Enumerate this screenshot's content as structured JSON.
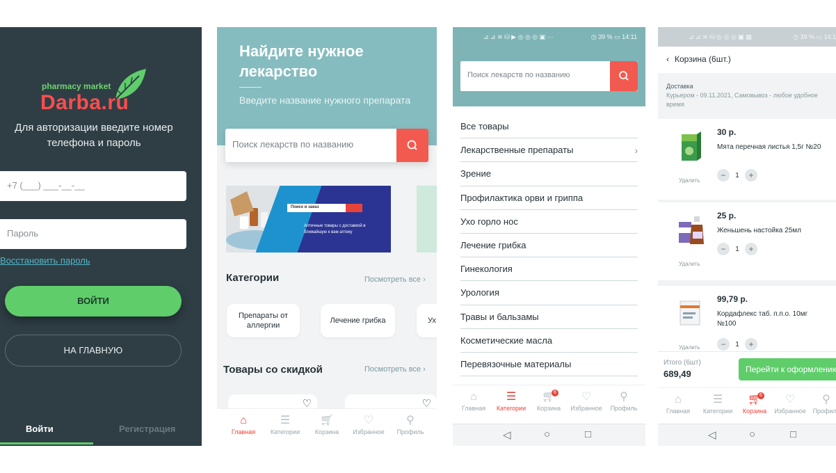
{
  "login_screen": {
    "logo_small": "pharmacy market",
    "logo_big": "Darba.ru",
    "auth_prompt": "Для авторизации введите номер телефона и пароль",
    "phone_placeholder": "+7 (___) ___-__-__",
    "password_placeholder": "Пароль",
    "restore_link": "Восстановить пароль",
    "login_button": "ВОЙТИ",
    "home_button": "НА ГЛАВНУЮ",
    "tabs": [
      "Войти",
      "Регистрация"
    ],
    "colors": {
      "background": "#2f3e45",
      "accent": "#5ecd6a",
      "brand_red": "#ff4d4d"
    }
  },
  "home_screen": {
    "hero_title": "Найдите нужное лекарство",
    "hero_subtitle": "Введите название нужного препарата",
    "search_placeholder": "Поиск лекарств по названию",
    "banner": {
      "search_text": "Поиск и заказ",
      "text": "Аптечные товары с доставкой в ближайшую к вам аптеку"
    },
    "categories_title": "Категории",
    "categories_see_all": "Посмотреть все",
    "categories": [
      "Препараты от аллергии",
      "Лечение грибка",
      "Ух"
    ],
    "discount_title": "Товары со скидкой",
    "discount_see_all": "Посмотреть все",
    "colors": {
      "hero": "#85bcbf",
      "search_button": "#f25a4f"
    }
  },
  "tabbar": {
    "items": [
      {
        "label": "Главная",
        "icon": "home-icon"
      },
      {
        "label": "Категории",
        "icon": "menu-icon"
      },
      {
        "label": "Корзина",
        "icon": "cart-icon"
      },
      {
        "label": "Избранное",
        "icon": "heart-icon"
      },
      {
        "label": "Профиль",
        "icon": "user-icon"
      }
    ],
    "cart_badge": "6"
  },
  "categories_screen": {
    "status_left": "⊿ ⊿ ≋ ⛁ ▶ ◎ ◎ ◎ ▣ ···",
    "status_right": "◷ 39 % ▭ 14:11",
    "search_placeholder": "Поиск лекарств по названию",
    "items": [
      "Все товары",
      "Лекарственные препараты",
      "Зрение",
      "Профилактика орви и гриппа",
      "Ухо горло нос",
      "Лечение грибка",
      "Гинекология",
      "Урология",
      "Травы и бальзамы",
      "Косметические масла",
      "Перевязочные материалы"
    ]
  },
  "cart_screen": {
    "status_left": "⊿ ⊿ ≋ ⛁ ◎ ◎ ◎ ▣ ▦",
    "status_right": "◷ 39 % ▭ 14:1",
    "title": "Корзина (6шт.)",
    "delivery_heading": "Доставка",
    "delivery_text": "Курьером - 09.11.2021, Самовывоз - любое удобное время",
    "items": [
      {
        "price": "30 р.",
        "name": "Мята перечная листья 1,5г №20",
        "qty": "1",
        "remove": "Удалить"
      },
      {
        "price": "25 р.",
        "name": "Женьшень настойка 25мл",
        "qty": "1",
        "remove": "Удалить"
      },
      {
        "price": "99,79 р.",
        "name": "Кордафлекс таб. п.п.о. 10мг №100",
        "qty": "1",
        "remove": "Удалить"
      }
    ],
    "total_label": "Итого (6шт)",
    "total_value": "689,49",
    "checkout_button": "Перейти к оформлению"
  },
  "android_nav": {
    "back": "◁",
    "home": "○",
    "recent": "□"
  }
}
